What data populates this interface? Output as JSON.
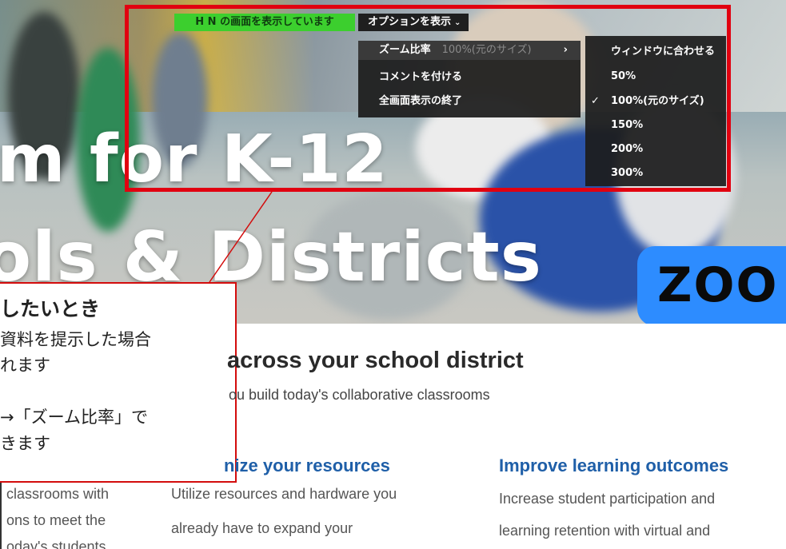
{
  "hero": {
    "headline_line1": "m for K-12",
    "headline_line2": "ols & Districts",
    "brand_badge": "ZOO"
  },
  "screen_share": {
    "sharing_label": "H N の画面を表示しています",
    "options_button": "オプションを表示",
    "options_chevron": "⌄",
    "menu": {
      "items": [
        {
          "label": "ズーム比率",
          "value": "100%(元のサイズ)",
          "arrow": "›"
        },
        {
          "label": "コメントを付ける"
        },
        {
          "label": "全画面表示の終了"
        }
      ]
    },
    "zoom_submenu": {
      "check_mark": "✓",
      "items": [
        {
          "label": "ウィンドウに合わせる"
        },
        {
          "label": "50%"
        },
        {
          "label": "100%(元のサイズ)"
        },
        {
          "label": "150%"
        },
        {
          "label": "200%"
        },
        {
          "label": "300%"
        }
      ],
      "selected": "100%(元のサイズ)"
    }
  },
  "callout": {
    "title": "したいとき",
    "line1": "資料を提示した場合",
    "line2": "れます",
    "line3": "→「ズーム比率」で",
    "line4": "きます"
  },
  "content": {
    "section_title": "across your school district",
    "section_subtitle": "ou build today's collaborative classrooms",
    "left_column": {
      "line1": "classrooms with",
      "line2": "ons to meet the",
      "line3": "oday's students"
    },
    "middle_column": {
      "title": "nize your resources",
      "line1": "Utilize resources and hardware you",
      "line2": "already have to expand your"
    },
    "right_column": {
      "title": "Improve learning outcomes",
      "line1": "Increase student participation and",
      "line2": "learning retention with virtual and"
    }
  },
  "colors": {
    "highlight_red": "#e10010",
    "share_green": "#3ccf2e",
    "zoom_blue": "#2d8cff",
    "link_blue": "#1f5fa8"
  }
}
